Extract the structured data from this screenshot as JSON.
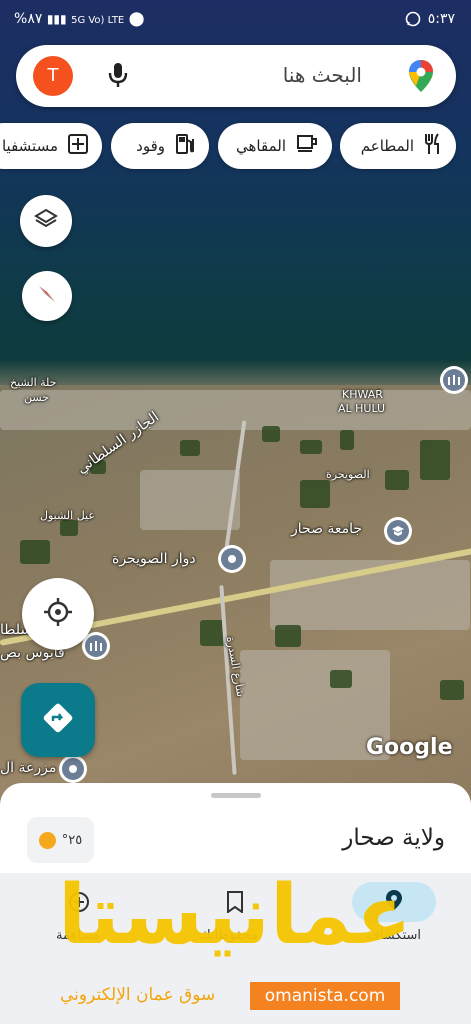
{
  "status_bar": {
    "time": "٥:٣٧",
    "battery": "%٨٧",
    "signal": "5G Vo) LTE"
  },
  "search": {
    "placeholder": "البحث هنا",
    "avatar_letter": "T"
  },
  "chips": [
    {
      "label": "المطاعم",
      "icon": "fork-knife-icon"
    },
    {
      "label": "المقاهي",
      "icon": "coffee-cup-icon"
    },
    {
      "label": "وقود",
      "icon": "gas-pump-icon"
    },
    {
      "label": "مستشفيا",
      "icon": "hospital-plus-icon"
    }
  ],
  "map_labels": {
    "khwar": "KHWAR",
    "al_hulu": "AL HULU",
    "hillat_shaikh": "حلة الشيخ",
    "hasan": "حسن",
    "jazir": "الجازر السلطاني",
    "suwaihra": "الصويحرة",
    "sohar_university": "جامعة صحار",
    "ghayl": "غيل الشبول",
    "roundabout": "دوار الصويحرة",
    "qaboos": "قابوس بص",
    "sultan_partial": "سلطا",
    "street_sidra": "شارع السدرة",
    "farm": "مزرعة ال",
    "google": "Google"
  },
  "sheet": {
    "region_title": "ولاية صحار",
    "temperature": "°٢٥"
  },
  "tabs": {
    "explore": "استكشاف",
    "saved": "محفوظاتك",
    "contribute": "مساهمة"
  },
  "watermark": {
    "brand": "عمانيستا",
    "tagline": "سوق عمان الإلكتروني",
    "url": "omanista.com"
  },
  "colors": {
    "accent_teal": "#0b7a8a",
    "avatar": "#f4511e",
    "explore_pill": "#c7e6f4"
  }
}
